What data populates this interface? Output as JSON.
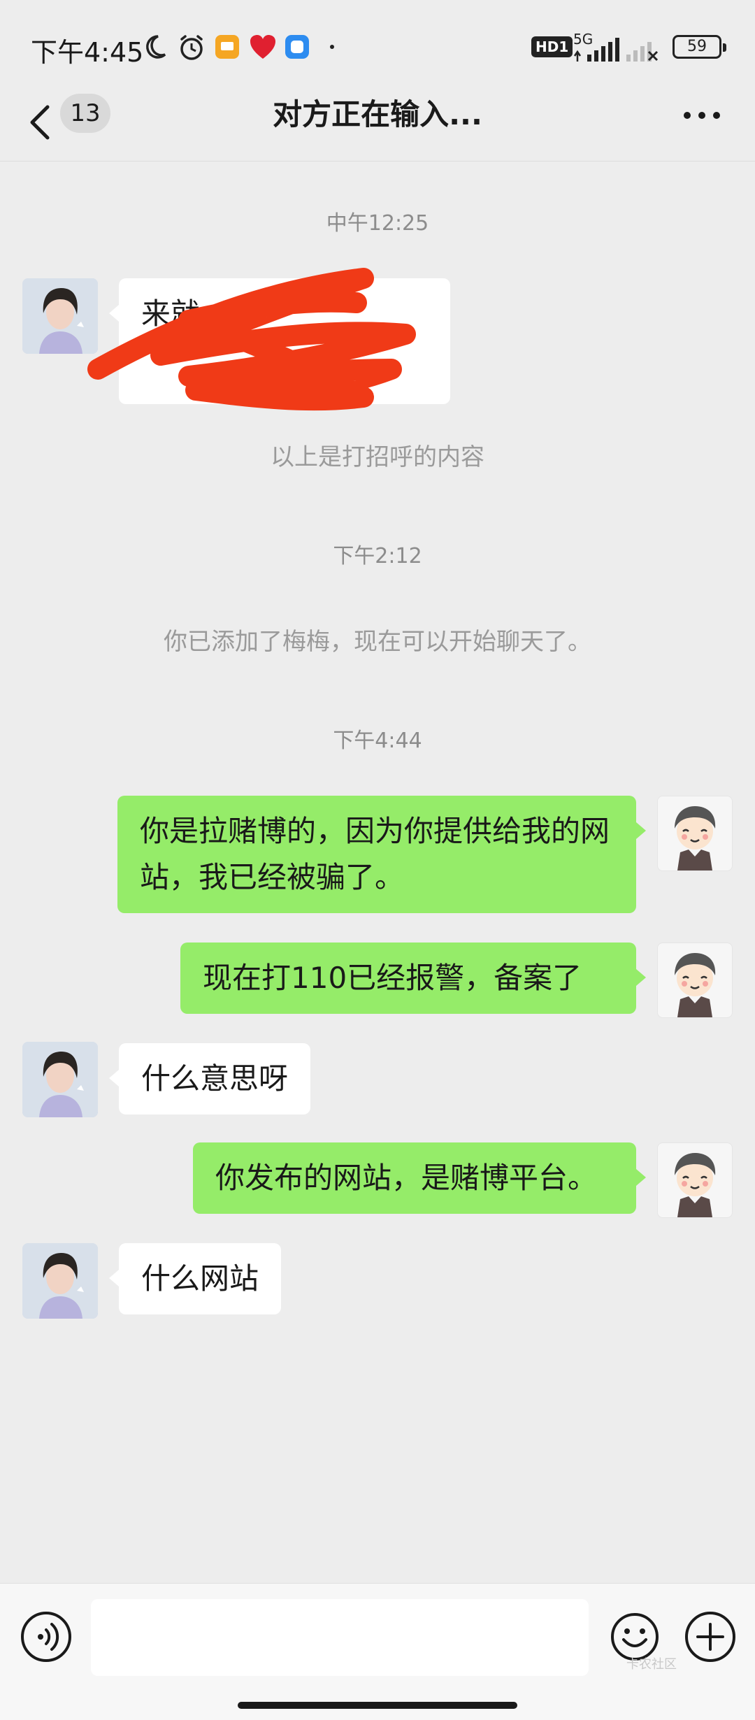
{
  "status_bar": {
    "time": "下午4:45",
    "network": "5G",
    "hd": "HD1",
    "battery": "59"
  },
  "nav": {
    "unread_count": "13",
    "title": "对方正在输入..."
  },
  "chat": {
    "ts_1": "中午12:25",
    "greeting_text_visible": "来就",
    "greeting_note": "以上是打招呼的内容",
    "ts_2": "下午2:12",
    "added_note": "你已添加了梅梅，现在可以开始聊天了。",
    "ts_3": "下午4:44",
    "msg_out_1": "你是拉赌博的，因为你提供给我的网站，我已经被骗了。",
    "msg_out_2": "现在打110已经报警，备案了",
    "msg_in_1": "什么意思呀",
    "msg_out_3": "你发布的网站，是赌博平台。",
    "msg_in_2": "什么网站"
  },
  "input": {
    "placeholder": ""
  },
  "watermark": "卡农社区",
  "colors": {
    "background": "#ededed",
    "outgoing_bubble": "#95ec69",
    "incoming_bubble": "#ffffff",
    "scribble": "#f03a17"
  }
}
